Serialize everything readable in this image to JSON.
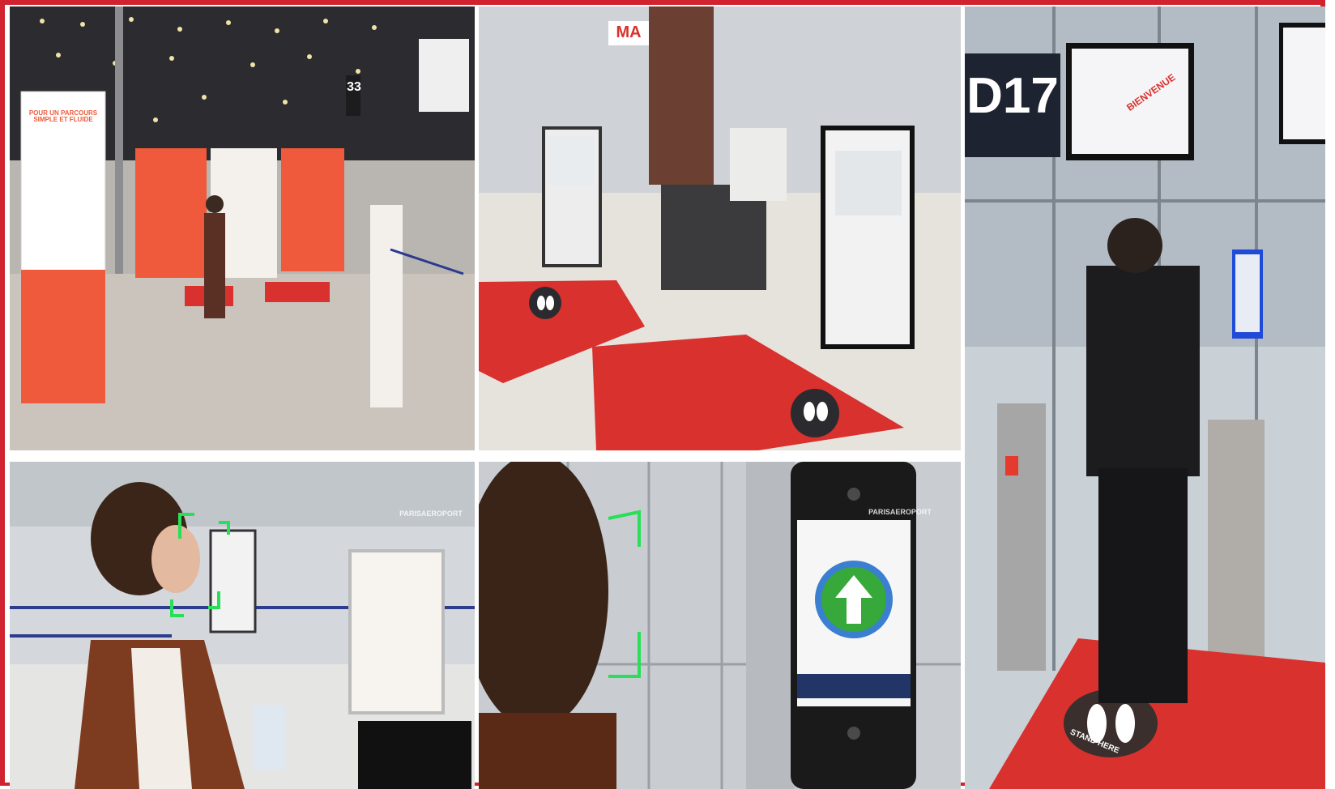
{
  "colors": {
    "frame_red": "#d0232f",
    "banner_orange": "#ee5a3b",
    "mat_red": "#d8312e",
    "face_green": "#27e057",
    "arrow_green": "#37a83a",
    "screen_blue": "#1f4bd8",
    "floor_grey": "#cfcac4"
  },
  "panels": {
    "p1": {
      "banner_title": "POUR UN PARCOURS SIMPLE ET FLUIDE",
      "pillar_number": "33"
    },
    "p2": {
      "sign_logo": "MA"
    },
    "p3": {
      "gate_number": "D17",
      "screen_text": "BIENVENUE"
    },
    "p4": {
      "watermark": "PARISAEROPORT"
    },
    "p5": {
      "watermark": "PARISAEROPORT",
      "arrow_icon": "up-arrow-icon"
    },
    "p6": {
      "floor_text": "STAND HERE"
    }
  }
}
